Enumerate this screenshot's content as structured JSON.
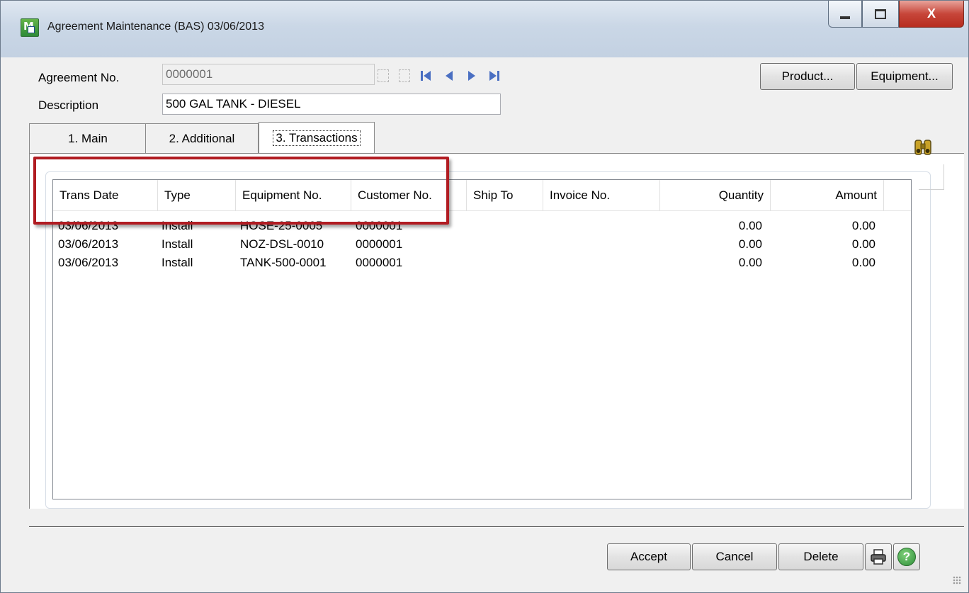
{
  "window": {
    "title": "Agreement Maintenance (BAS) 03/06/2013",
    "close_glyph": "X"
  },
  "header": {
    "agreement_label": "Agreement No.",
    "agreement_value": "0000001",
    "description_label": "Description",
    "description_value": "500 GAL TANK - DIESEL",
    "product_button": "Product...",
    "equipment_button": "Equipment..."
  },
  "tabs": [
    {
      "label": "1. Main",
      "active": false
    },
    {
      "label": "2. Additional",
      "active": false
    },
    {
      "label": "3. Transactions",
      "active": true
    }
  ],
  "grid": {
    "columns": [
      "Trans Date",
      "Type",
      "Equipment No.",
      "Customer No.",
      "Ship To",
      "Invoice No.",
      "Quantity",
      "Amount"
    ],
    "rows": [
      [
        "03/06/2013",
        "Install",
        "HOSE-25-0005",
        "0000001",
        "",
        "",
        "0.00",
        "0.00"
      ],
      [
        "03/06/2013",
        "Install",
        "NOZ-DSL-0010",
        "0000001",
        "",
        "",
        "0.00",
        "0.00"
      ],
      [
        "03/06/2013",
        "Install",
        "TANK-500-0001",
        "0000001",
        "",
        "",
        "0.00",
        "0.00"
      ]
    ]
  },
  "footer": {
    "accept_button": "Accept",
    "cancel_button": "Cancel",
    "delete_button": "Delete",
    "help_glyph": "?"
  },
  "colors": {
    "highlight": "#b11c22",
    "nav_arrows": "#4a6fc2",
    "close_button": "#c7463a"
  },
  "icons": [
    "app-icon",
    "minimize-icon",
    "maximize-icon",
    "close-icon",
    "first-record-icon",
    "previous-record-icon",
    "next-record-icon",
    "last-record-icon",
    "binoculars-icon",
    "printer-icon",
    "help-icon"
  ]
}
